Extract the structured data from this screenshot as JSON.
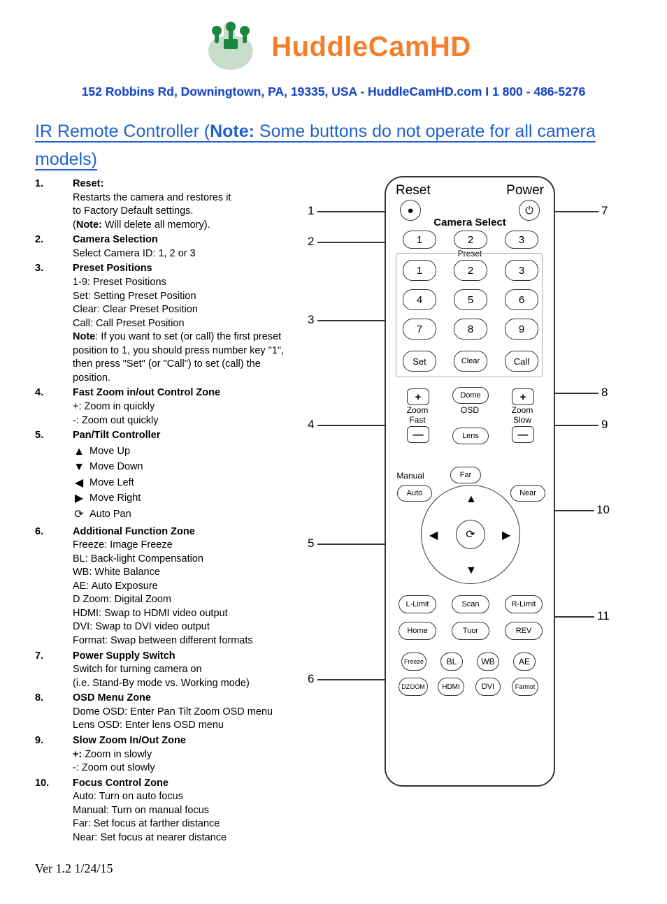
{
  "brand": "HuddleCamHD",
  "address": "152 Robbins Rd, Downingtown, PA, 19335, USA - HuddleCamHD.com I 1 800 - 486-5276",
  "title_pre": "IR Remote Controller (",
  "title_note": "Note:",
  "title_post": " Some buttons do not operate for all camera models)",
  "version": "Ver 1.2 1/24/15",
  "items": [
    {
      "n": "1.",
      "head": "Reset:",
      "lines": [
        "Restarts the camera and restores it",
        "to Factory Default settings."
      ],
      "note_pre": "(",
      "note_b": "Note:",
      "note_post": " Will delete all memory)."
    },
    {
      "n": "2.",
      "head": "Camera Selection",
      "lines": [
        "Select Camera ID: 1, 2 or 3"
      ]
    },
    {
      "n": "3.",
      "head": "Preset Positions",
      "lines": [
        "1-9: Preset Positions",
        "Set: Setting Preset Position",
        "Clear: Clear Preset Position",
        "Call: Call Preset Position"
      ],
      "note_b2": "Note",
      "note_post2": ": If you want to set (or call) the first preset position to 1, you should press number key \"1\", then press \"Set\" (or \"Call\") to set (call) the position."
    },
    {
      "n": "4.",
      "head": "Fast Zoom in/out Control Zone",
      "lines": [
        "+: Zoom in quickly",
        "-: Zoom out quickly"
      ]
    },
    {
      "n": "5.",
      "head": "Pan/Tilt Controller",
      "pan": [
        {
          "icon": "↑",
          "txt": "Move Up"
        },
        {
          "icon": "↓",
          "txt": "Move Down"
        },
        {
          "icon": "←",
          "txt": "Move Left"
        },
        {
          "icon": "→",
          "txt": "Move Right"
        },
        {
          "icon": "↻",
          "txt": "Auto Pan"
        }
      ]
    },
    {
      "n": "6.",
      "head": "Additional Function Zone",
      "lines": [
        "Freeze: Image Freeze",
        "BL: Back-light Compensation",
        "WB: White Balance",
        "AE: Auto Exposure",
        "D Zoom: Digital Zoom",
        "HDMI: Swap to HDMI video output",
        "DVI: Swap to DVI video output",
        "Format: Swap between different formats"
      ]
    },
    {
      "n": "7.",
      "head": "Power Supply Switch",
      "lines": [
        "Switch for turning camera on",
        "(i.e. Stand-By mode vs. Working mode)"
      ]
    },
    {
      "n": "8.",
      "head": "OSD Menu Zone",
      "lines": [
        "Dome OSD: Enter Pan Tilt Zoom OSD menu",
        "Lens OSD: Enter lens OSD menu"
      ]
    },
    {
      "n": "9.",
      "head": "Slow Zoom In/Out Zone",
      "plus_b": "+:",
      "plus_t": " Zoom in slowly",
      "lines": [
        " -: Zoom out slowly"
      ]
    },
    {
      "n": "10.",
      "head": "Focus Control Zone",
      "lines": [
        "Auto: Turn on auto focus",
        "Manual: Turn on manual focus",
        "Far: Set focus at farther distance",
        "Near: Set focus at nearer distance"
      ]
    }
  ],
  "callouts_left": [
    "1",
    "2",
    "3",
    "4",
    "5",
    "6"
  ],
  "callouts_right": [
    "7",
    "8",
    "9",
    "10",
    "11"
  ],
  "remote": {
    "reset": "Reset",
    "power": "Power",
    "camsel": "Camera Select",
    "preset_lbl": "Preset",
    "cs": [
      "1",
      "2",
      "3"
    ],
    "preset": [
      "1",
      "2",
      "3",
      "4",
      "5",
      "6",
      "7",
      "8",
      "9"
    ],
    "set": "Set",
    "clear": "Clear",
    "call": "Call",
    "zoom": "Zoom",
    "fast": "Fast",
    "slow": "Slow",
    "dome": "Dome",
    "osd": "OSD",
    "lens": "Lens",
    "plus": "+",
    "minus": "—",
    "manual": "Manual",
    "far": "Far",
    "auto": "Auto",
    "near": "Near",
    "llimit": "L-Limit",
    "scan": "Scan",
    "rlimit": "R-Limit",
    "home": "Home",
    "tuor": "Tuor",
    "rev": "REV",
    "freeze": "Freeze",
    "bl": "BL",
    "wb": "WB",
    "ae": "AE",
    "dzoom": "DZOOM",
    "hdmi": "HDMI",
    "dvi": "DVI",
    "format": "Farmot"
  }
}
